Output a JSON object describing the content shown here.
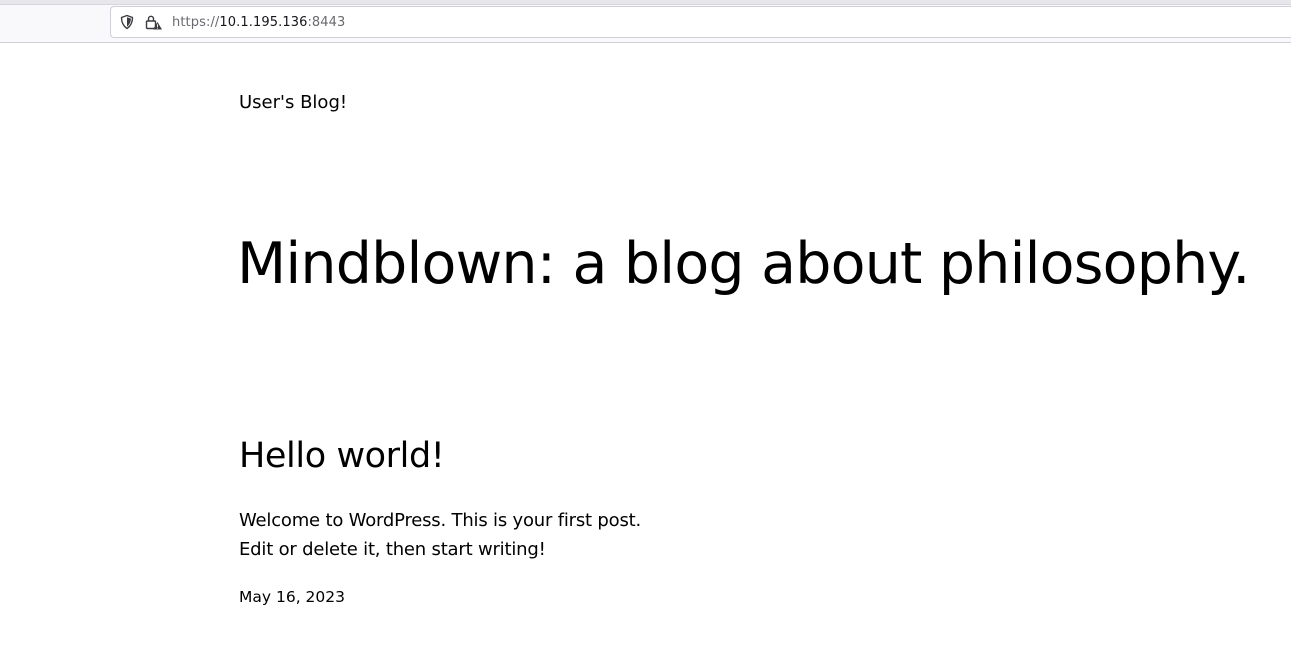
{
  "browser": {
    "url_scheme": "https://",
    "url_host": "10.1.195.136",
    "url_port": ":8443",
    "icons": [
      "shield-icon",
      "lock-warning-icon"
    ]
  },
  "site": {
    "title": "User's Blog!",
    "tagline": "Mindblown: a blog about philosophy."
  },
  "post": {
    "title": "Hello world!",
    "paragraphs": [
      "Welcome to WordPress. This is your first post.",
      "Edit or delete it, then start writing!"
    ],
    "date": "May 16, 2023"
  }
}
